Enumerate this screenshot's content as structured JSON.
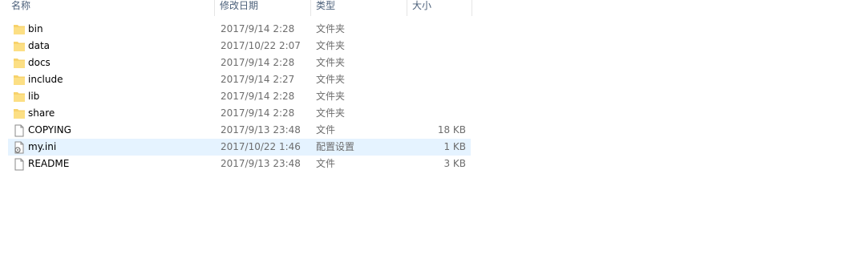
{
  "columns": {
    "name": "名称",
    "date": "修改日期",
    "type": "类型",
    "size": "大小"
  },
  "files": [
    {
      "name": "bin",
      "date": "2017/9/14 2:28",
      "type": "文件夹",
      "size": "",
      "icon": "folder-icon"
    },
    {
      "name": "data",
      "date": "2017/10/22 2:07",
      "type": "文件夹",
      "size": "",
      "icon": "folder-icon"
    },
    {
      "name": "docs",
      "date": "2017/9/14 2:28",
      "type": "文件夹",
      "size": "",
      "icon": "folder-icon"
    },
    {
      "name": "include",
      "date": "2017/9/14 2:27",
      "type": "文件夹",
      "size": "",
      "icon": "folder-icon"
    },
    {
      "name": "lib",
      "date": "2017/9/14 2:28",
      "type": "文件夹",
      "size": "",
      "icon": "folder-icon"
    },
    {
      "name": "share",
      "date": "2017/9/14 2:28",
      "type": "文件夹",
      "size": "",
      "icon": "folder-icon"
    },
    {
      "name": "COPYING",
      "date": "2017/9/13 23:48",
      "type": "文件",
      "size": "18 KB",
      "icon": "file-icon"
    },
    {
      "name": "my.ini",
      "date": "2017/10/22 1:46",
      "type": "配置设置",
      "size": "1 KB",
      "icon": "settings-file-icon"
    },
    {
      "name": "README",
      "date": "2017/9/13 23:48",
      "type": "文件",
      "size": "3 KB",
      "icon": "file-icon"
    }
  ],
  "selected_file": "my.ini",
  "colors": {
    "selection": "#e5f3ff",
    "header_text": "#4c607a",
    "folder": "#f7d26b",
    "secondary_text": "#6d6d6d"
  }
}
